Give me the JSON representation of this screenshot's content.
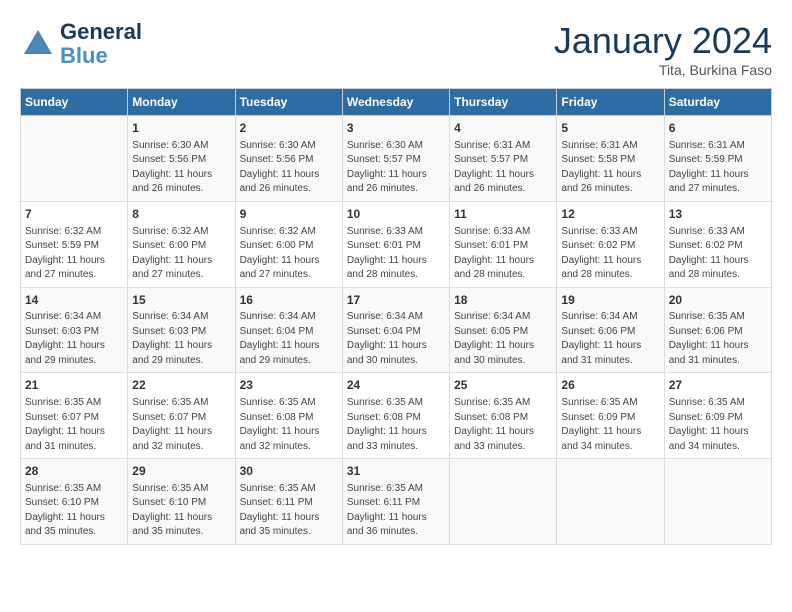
{
  "header": {
    "logo_line1": "General",
    "logo_line2": "Blue",
    "month": "January 2024",
    "location": "Tita, Burkina Faso"
  },
  "days_of_week": [
    "Sunday",
    "Monday",
    "Tuesday",
    "Wednesday",
    "Thursday",
    "Friday",
    "Saturday"
  ],
  "weeks": [
    [
      {
        "day": "",
        "info": ""
      },
      {
        "day": "1",
        "info": "Sunrise: 6:30 AM\nSunset: 5:56 PM\nDaylight: 11 hours\nand 26 minutes."
      },
      {
        "day": "2",
        "info": "Sunrise: 6:30 AM\nSunset: 5:56 PM\nDaylight: 11 hours\nand 26 minutes."
      },
      {
        "day": "3",
        "info": "Sunrise: 6:30 AM\nSunset: 5:57 PM\nDaylight: 11 hours\nand 26 minutes."
      },
      {
        "day": "4",
        "info": "Sunrise: 6:31 AM\nSunset: 5:57 PM\nDaylight: 11 hours\nand 26 minutes."
      },
      {
        "day": "5",
        "info": "Sunrise: 6:31 AM\nSunset: 5:58 PM\nDaylight: 11 hours\nand 26 minutes."
      },
      {
        "day": "6",
        "info": "Sunrise: 6:31 AM\nSunset: 5:59 PM\nDaylight: 11 hours\nand 27 minutes."
      }
    ],
    [
      {
        "day": "7",
        "info": "Sunrise: 6:32 AM\nSunset: 5:59 PM\nDaylight: 11 hours\nand 27 minutes."
      },
      {
        "day": "8",
        "info": "Sunrise: 6:32 AM\nSunset: 6:00 PM\nDaylight: 11 hours\nand 27 minutes."
      },
      {
        "day": "9",
        "info": "Sunrise: 6:32 AM\nSunset: 6:00 PM\nDaylight: 11 hours\nand 27 minutes."
      },
      {
        "day": "10",
        "info": "Sunrise: 6:33 AM\nSunset: 6:01 PM\nDaylight: 11 hours\nand 28 minutes."
      },
      {
        "day": "11",
        "info": "Sunrise: 6:33 AM\nSunset: 6:01 PM\nDaylight: 11 hours\nand 28 minutes."
      },
      {
        "day": "12",
        "info": "Sunrise: 6:33 AM\nSunset: 6:02 PM\nDaylight: 11 hours\nand 28 minutes."
      },
      {
        "day": "13",
        "info": "Sunrise: 6:33 AM\nSunset: 6:02 PM\nDaylight: 11 hours\nand 28 minutes."
      }
    ],
    [
      {
        "day": "14",
        "info": "Sunrise: 6:34 AM\nSunset: 6:03 PM\nDaylight: 11 hours\nand 29 minutes."
      },
      {
        "day": "15",
        "info": "Sunrise: 6:34 AM\nSunset: 6:03 PM\nDaylight: 11 hours\nand 29 minutes."
      },
      {
        "day": "16",
        "info": "Sunrise: 6:34 AM\nSunset: 6:04 PM\nDaylight: 11 hours\nand 29 minutes."
      },
      {
        "day": "17",
        "info": "Sunrise: 6:34 AM\nSunset: 6:04 PM\nDaylight: 11 hours\nand 30 minutes."
      },
      {
        "day": "18",
        "info": "Sunrise: 6:34 AM\nSunset: 6:05 PM\nDaylight: 11 hours\nand 30 minutes."
      },
      {
        "day": "19",
        "info": "Sunrise: 6:34 AM\nSunset: 6:06 PM\nDaylight: 11 hours\nand 31 minutes."
      },
      {
        "day": "20",
        "info": "Sunrise: 6:35 AM\nSunset: 6:06 PM\nDaylight: 11 hours\nand 31 minutes."
      }
    ],
    [
      {
        "day": "21",
        "info": "Sunrise: 6:35 AM\nSunset: 6:07 PM\nDaylight: 11 hours\nand 31 minutes."
      },
      {
        "day": "22",
        "info": "Sunrise: 6:35 AM\nSunset: 6:07 PM\nDaylight: 11 hours\nand 32 minutes."
      },
      {
        "day": "23",
        "info": "Sunrise: 6:35 AM\nSunset: 6:08 PM\nDaylight: 11 hours\nand 32 minutes."
      },
      {
        "day": "24",
        "info": "Sunrise: 6:35 AM\nSunset: 6:08 PM\nDaylight: 11 hours\nand 33 minutes."
      },
      {
        "day": "25",
        "info": "Sunrise: 6:35 AM\nSunset: 6:08 PM\nDaylight: 11 hours\nand 33 minutes."
      },
      {
        "day": "26",
        "info": "Sunrise: 6:35 AM\nSunset: 6:09 PM\nDaylight: 11 hours\nand 34 minutes."
      },
      {
        "day": "27",
        "info": "Sunrise: 6:35 AM\nSunset: 6:09 PM\nDaylight: 11 hours\nand 34 minutes."
      }
    ],
    [
      {
        "day": "28",
        "info": "Sunrise: 6:35 AM\nSunset: 6:10 PM\nDaylight: 11 hours\nand 35 minutes."
      },
      {
        "day": "29",
        "info": "Sunrise: 6:35 AM\nSunset: 6:10 PM\nDaylight: 11 hours\nand 35 minutes."
      },
      {
        "day": "30",
        "info": "Sunrise: 6:35 AM\nSunset: 6:11 PM\nDaylight: 11 hours\nand 35 minutes."
      },
      {
        "day": "31",
        "info": "Sunrise: 6:35 AM\nSunset: 6:11 PM\nDaylight: 11 hours\nand 36 minutes."
      },
      {
        "day": "",
        "info": ""
      },
      {
        "day": "",
        "info": ""
      },
      {
        "day": "",
        "info": ""
      }
    ]
  ]
}
